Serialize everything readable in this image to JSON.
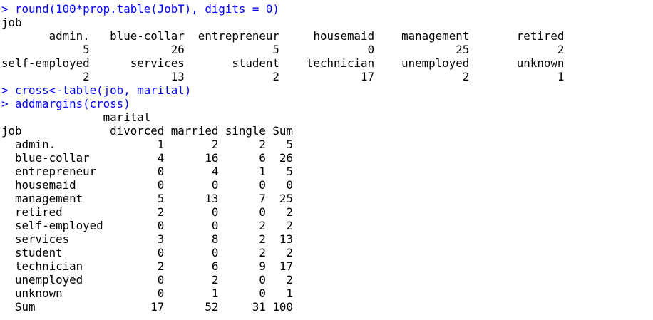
{
  "console": {
    "colors": {
      "command": "#0000ff",
      "output": "#000000",
      "background": "#ffffff"
    },
    "lines": [
      {
        "kind": "cmd",
        "text": "> round(100*prop.table(JobT), digits = 0)"
      },
      {
        "kind": "out",
        "text": "job"
      },
      {
        "kind": "out",
        "text": "       admin.   blue-collar  entrepreneur     housemaid    management       retired"
      },
      {
        "kind": "out",
        "text": "            5            26             5             0            25             2"
      },
      {
        "kind": "out",
        "text": "self-employed      services       student    technician    unemployed       unknown"
      },
      {
        "kind": "out",
        "text": "            2            13             2            17             2             1"
      },
      {
        "kind": "cmd",
        "text": "> cross<-table(job, marital)"
      },
      {
        "kind": "cmd",
        "text": "> addmargins(cross)"
      },
      {
        "kind": "out",
        "text": "               marital"
      },
      {
        "kind": "out",
        "text": "job             divorced married single Sum"
      },
      {
        "kind": "out",
        "text": "  admin.               1       2      2   5"
      },
      {
        "kind": "out",
        "text": "  blue-collar          4      16      6  26"
      },
      {
        "kind": "out",
        "text": "  entrepreneur         0       4      1   5"
      },
      {
        "kind": "out",
        "text": "  housemaid            0       0      0   0"
      },
      {
        "kind": "out",
        "text": "  management           5      13      7  25"
      },
      {
        "kind": "out",
        "text": "  retired              2       0      0   2"
      },
      {
        "kind": "out",
        "text": "  self-employed        0       0      2   2"
      },
      {
        "kind": "out",
        "text": "  services             3       8      2  13"
      },
      {
        "kind": "out",
        "text": "  student              0       0      2   2"
      },
      {
        "kind": "out",
        "text": "  technician           2       6      9  17"
      },
      {
        "kind": "out",
        "text": "  unemployed           0       2      0   2"
      },
      {
        "kind": "out",
        "text": "  unknown              0       1      0   1"
      },
      {
        "kind": "out",
        "text": "  Sum                 17      52     31 100"
      }
    ]
  }
}
